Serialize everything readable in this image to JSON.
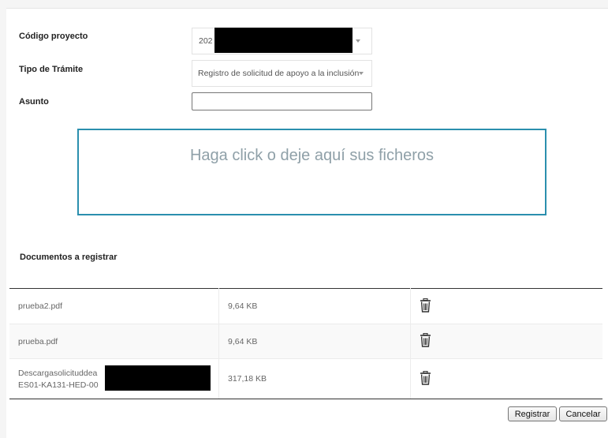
{
  "form": {
    "codigo_label": "Código proyecto",
    "codigo_value": "202",
    "tipo_label": "Tipo de Trámite",
    "tipo_value": "Registro de solicitud de apoyo a la inclusión",
    "asunto_label": "Asunto",
    "asunto_value": ""
  },
  "dropzone": {
    "text": "Haga click o deje aquí sus ficheros"
  },
  "documents": {
    "title": "Documentos a registrar",
    "rows": [
      {
        "name": "prueba2.pdf",
        "size": "9,64 KB"
      },
      {
        "name": "prueba.pdf",
        "size": "9,64 KB"
      },
      {
        "name_line1": "Descargasolicituddea",
        "name_line2": "ES01-KA131-HED-00",
        "size": "317,18 KB"
      }
    ]
  },
  "buttons": {
    "registrar": "Registrar",
    "cancelar": "Cancelar"
  },
  "icons": {
    "select_arrow": "chevron-down-icon",
    "delete": "trash-icon"
  },
  "colors": {
    "dropzone_border": "#2b8fae",
    "dropzone_text": "#8fa0a8"
  }
}
